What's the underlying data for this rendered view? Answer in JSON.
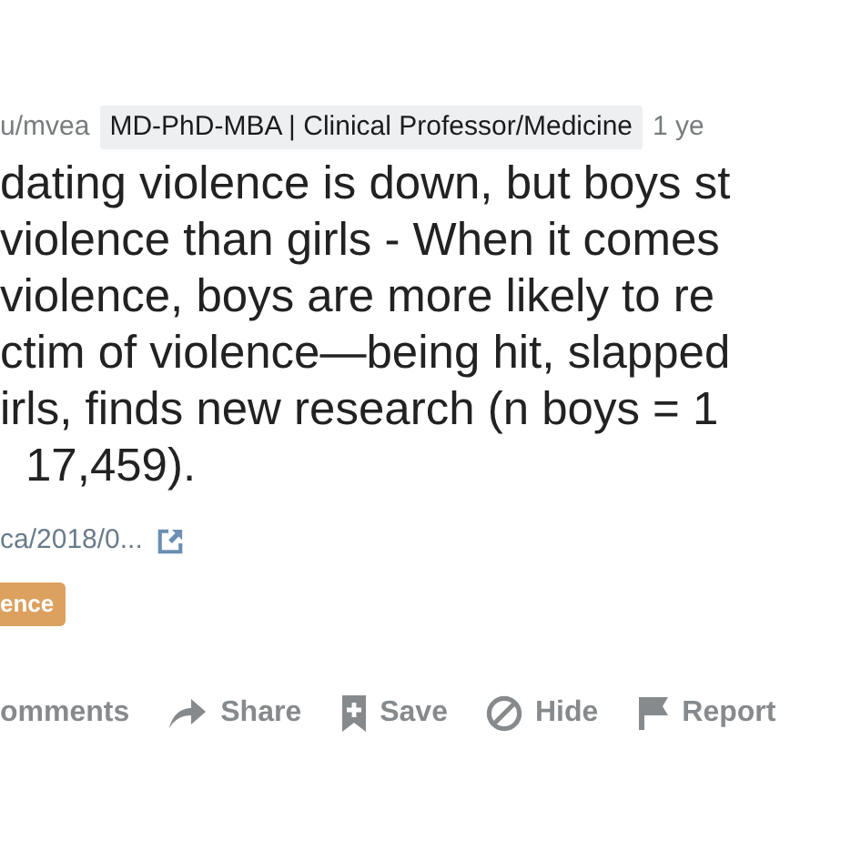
{
  "post": {
    "author": "u/mvea",
    "author_flair": "MD-PhD-MBA | Clinical Professor/Medicine",
    "time": "1 ye",
    "title_lines": [
      "dating violence is down, but boys st",
      "violence than girls - When it comes",
      "violence, boys are more likely to re",
      "ctim of violence—being hit, slapped",
      "irls, finds new research (n boys = 1",
      "17,459)."
    ],
    "link": "ca/2018/0...",
    "flair": "ence",
    "actions": [
      {
        "kind": "comments",
        "label": "omments"
      },
      {
        "kind": "share",
        "label": "Share"
      },
      {
        "kind": "save",
        "label": "Save"
      },
      {
        "kind": "hide",
        "label": "Hide"
      },
      {
        "kind": "report",
        "label": "Report"
      }
    ]
  }
}
